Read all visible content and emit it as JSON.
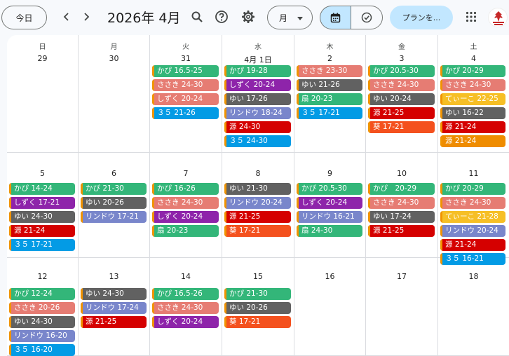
{
  "toolbar": {
    "today_label": "今日",
    "month_title": "2026年 4月",
    "view_label": "月",
    "plan_label": "プランを..."
  },
  "icons": [
    "chevron-left-icon",
    "chevron-right-icon",
    "search-icon",
    "help-icon",
    "settings-icon",
    "calendar-icon",
    "check-circle-icon",
    "apps-grid-icon",
    "avatar-logo"
  ],
  "colors": {
    "green": "#33b679",
    "salmon": "#e67c73",
    "purple": "#8e24aa",
    "graphite": "#616161",
    "lavender": "#7986cb",
    "tomato": "#d50000",
    "peacock": "#039be5",
    "tangerine": "#f4511e",
    "banana": "#f6bf26",
    "pumpkin": "#ef8c00",
    "accent_blue": "#c2e7ff"
  },
  "weekdays": [
    "日",
    "月",
    "火",
    "水",
    "木",
    "金",
    "土"
  ],
  "weeks": [
    {
      "days": [
        {
          "num": "29",
          "events": []
        },
        {
          "num": "30",
          "events": []
        },
        {
          "num": "31",
          "events": [
            {
              "text": "かぴ 16.5-25",
              "color": "green"
            },
            {
              "text": "ささき 24-30",
              "color": "salmon"
            },
            {
              "text": "しずく 20-24",
              "color": "salmon"
            },
            {
              "text": "３５ 21-26",
              "color": "peacock"
            }
          ]
        },
        {
          "num": "4月 1日",
          "events": [
            {
              "text": "かぴ 19-28",
              "color": "green"
            },
            {
              "text": "しずく 20-24",
              "color": "purple"
            },
            {
              "text": "ゆい 17-26",
              "color": "graphite"
            },
            {
              "text": "リンドウ 18-24",
              "color": "lavender"
            },
            {
              "text": "源 24-30",
              "color": "tomato"
            },
            {
              "text": "３５ 24-30",
              "color": "peacock"
            }
          ]
        },
        {
          "num": "2",
          "events": [
            {
              "text": "ささき 23-30",
              "color": "salmon"
            },
            {
              "text": "ゆい 21-26",
              "color": "graphite"
            },
            {
              "text": "扇 20-23",
              "color": "green"
            },
            {
              "text": "３５ 17-21",
              "color": "peacock"
            }
          ]
        },
        {
          "num": "3",
          "events": [
            {
              "text": "かぴ 20.5-30",
              "color": "green"
            },
            {
              "text": "ささき 24-30",
              "color": "salmon"
            },
            {
              "text": "ゆい 20-24",
              "color": "graphite"
            },
            {
              "text": "源 21-25",
              "color": "tomato"
            },
            {
              "text": "葵 17-21",
              "color": "tangerine"
            }
          ]
        },
        {
          "num": "4",
          "events": [
            {
              "text": "かぴ 20-29",
              "color": "green"
            },
            {
              "text": "ささき 24-30",
              "color": "salmon"
            },
            {
              "text": "てぃーこ 22-25",
              "color": "banana"
            },
            {
              "text": "ゆい 16-22",
              "color": "graphite"
            },
            {
              "text": "源 21-24",
              "color": "tomato"
            },
            {
              "text": "源 21-24",
              "color": "pumpkin"
            }
          ]
        }
      ]
    },
    {
      "days": [
        {
          "num": "5",
          "events": [
            {
              "text": "かぴ 14-24",
              "color": "green"
            },
            {
              "text": "しずく 17-21",
              "color": "purple"
            },
            {
              "text": "ゆい 24-30",
              "color": "graphite"
            },
            {
              "text": "源 21-24",
              "color": "tomato"
            },
            {
              "text": "３５ 17-21",
              "color": "peacock"
            }
          ]
        },
        {
          "num": "6",
          "events": [
            {
              "text": "かぴ 21-30",
              "color": "green"
            },
            {
              "text": "ゆい 20-26",
              "color": "graphite"
            },
            {
              "text": "リンドウ 17-21",
              "color": "lavender"
            }
          ]
        },
        {
          "num": "7",
          "events": [
            {
              "text": "かぴ 16-26",
              "color": "green"
            },
            {
              "text": "ささき 24-30",
              "color": "salmon"
            },
            {
              "text": "しずく 20-24",
              "color": "purple"
            },
            {
              "text": "扇 20-23",
              "color": "green"
            }
          ]
        },
        {
          "num": "8",
          "events": [
            {
              "text": "ゆい 21-30",
              "color": "graphite"
            },
            {
              "text": "リンドウ 20-24",
              "color": "lavender"
            },
            {
              "text": "源 21-25",
              "color": "tomato"
            },
            {
              "text": "葵 17-21",
              "color": "tangerine"
            }
          ]
        },
        {
          "num": "9",
          "events": [
            {
              "text": "かぴ 20.5-30",
              "color": "green"
            },
            {
              "text": "しずく 20-24",
              "color": "purple"
            },
            {
              "text": "リンドウ 16-21",
              "color": "lavender"
            },
            {
              "text": "扇 24-30",
              "color": "green"
            }
          ]
        },
        {
          "num": "10",
          "events": [
            {
              "text": "かぴ　20-29",
              "color": "green"
            },
            {
              "text": "ささき 24-30",
              "color": "salmon"
            },
            {
              "text": "ゆい 17-24",
              "color": "graphite"
            },
            {
              "text": "源 21-25",
              "color": "tomato"
            }
          ]
        },
        {
          "num": "11",
          "events": [
            {
              "text": "かぴ 20-29",
              "color": "green"
            },
            {
              "text": "ささき 24-30",
              "color": "salmon"
            },
            {
              "text": "てぃーこ 21-28",
              "color": "banana"
            },
            {
              "text": "リンドウ 20-24",
              "color": "lavender"
            },
            {
              "text": "源 21-24",
              "color": "tomato"
            },
            {
              "text": "３５ 16-21",
              "color": "peacock"
            }
          ]
        }
      ]
    },
    {
      "days": [
        {
          "num": "12",
          "events": [
            {
              "text": "かぴ 12-24",
              "color": "green"
            },
            {
              "text": "ささき 20-26",
              "color": "salmon"
            },
            {
              "text": "ゆい 24-30",
              "color": "graphite"
            },
            {
              "text": "リンドウ 16-20",
              "color": "lavender"
            },
            {
              "text": "３５ 16-20",
              "color": "peacock"
            }
          ]
        },
        {
          "num": "13",
          "events": [
            {
              "text": "ゆい 24-30",
              "color": "graphite"
            },
            {
              "text": "リンドウ 17-24",
              "color": "lavender"
            },
            {
              "text": "源 21-25",
              "color": "tomato"
            }
          ]
        },
        {
          "num": "14",
          "events": [
            {
              "text": "かぴ 16.5-26",
              "color": "green"
            },
            {
              "text": "ささき 24-30",
              "color": "salmon"
            },
            {
              "text": "しずく 20-24",
              "color": "purple"
            }
          ]
        },
        {
          "num": "15",
          "events": [
            {
              "text": "かぴ 21-30",
              "color": "green"
            },
            {
              "text": "ゆい 20-26",
              "color": "graphite"
            },
            {
              "text": "葵 17-21",
              "color": "tangerine"
            }
          ]
        },
        {
          "num": "16",
          "events": []
        },
        {
          "num": "17",
          "events": []
        },
        {
          "num": "18",
          "events": []
        }
      ]
    }
  ]
}
